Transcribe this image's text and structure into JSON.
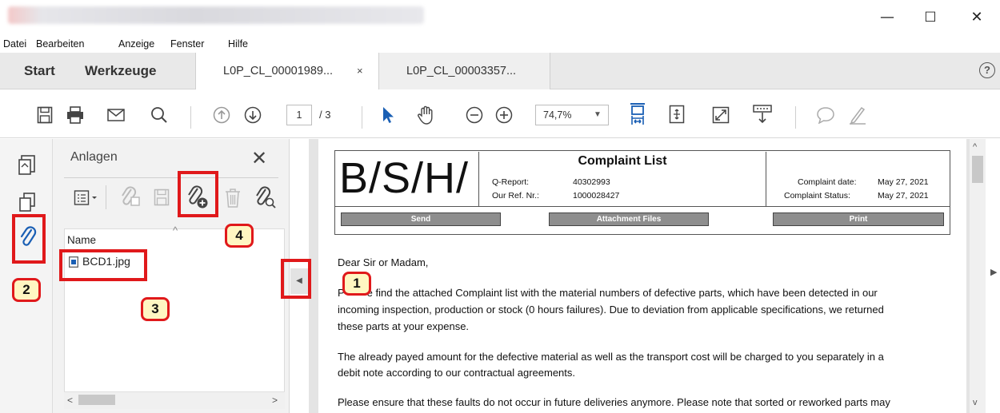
{
  "window": {
    "minimize_glyph": "—",
    "maximize_glyph": "☐",
    "close_glyph": "✕"
  },
  "menu": {
    "items": [
      "Datei",
      "Bearbeiten",
      "Anzeige",
      "Fenster",
      "Hilfe"
    ]
  },
  "tabs": {
    "start": "Start",
    "tools": "Werkzeuge",
    "doc1": "L0P_CL_00001989...",
    "doc1_close": "×",
    "doc2": "L0P_CL_00003357..."
  },
  "toolbar": {
    "page_current": "1",
    "page_total": "/ 3",
    "zoom": "74,7%",
    "zoom_arrow": "▼",
    "icons": [
      "save-icon",
      "print-icon",
      "email-icon",
      "search-icon",
      "prev-page-icon",
      "next-page-icon",
      "select-cursor-icon",
      "hand-tool-icon",
      "zoom-out-icon",
      "zoom-in-icon",
      "fit-width-icon",
      "fit-page-icon",
      "fullscreen-icon",
      "scroll-mode-icon",
      "comment-icon",
      "sign-icon"
    ]
  },
  "attachments": {
    "title": "Anlagen",
    "column_name": "Name",
    "file": "BCD1.jpg"
  },
  "document": {
    "logo": "B/S/H/",
    "title": "Complaint List",
    "q_report_label": "Q-Report:",
    "q_report_value": "40302993",
    "our_ref_label": "Our Ref. Nr.:",
    "our_ref_value": "1000028427",
    "complaint_date_label": "Complaint date:",
    "complaint_date_value": "May 27, 2021",
    "complaint_status_label": "Complaint Status:",
    "complaint_status_value": "May 27, 2021",
    "btn_send": "Send",
    "btn_attachments": "Attachment Files",
    "btn_print": "Print",
    "salutation": "Dear Sir or Madam,",
    "para1_a": "P",
    "para1_b": "e find the attached Complaint list with the material numbers of defective parts, which have been detected  in our",
    "para1_c": "incoming inspection, production or stock (0 hours failures). Due to deviation from applicable specifications, we returned",
    "para1_d": "these parts at your expense.",
    "para2_a": "The already payed amount for the defective material as well as the transport cost will be charged to you separately in a",
    "para2_b": "debit note according to our contractual agreements.",
    "para3_a": "Please ensure that these faults do not occur in future deliveries anymore. Please note that sorted or reworked parts may"
  },
  "annotations": {
    "badge1": "1",
    "badge2": "2",
    "badge3": "3",
    "badge4": "4",
    "color": "#e0191b"
  },
  "panel_toggle": {
    "collapse_glyph": "◀",
    "expand_glyph": "▶"
  },
  "help": {
    "glyph": "?"
  }
}
